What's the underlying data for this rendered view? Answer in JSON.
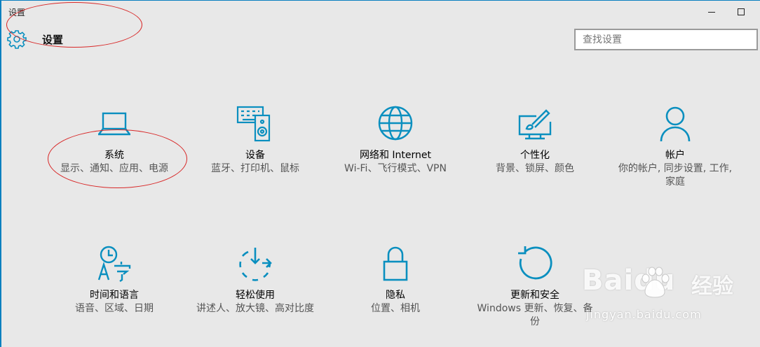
{
  "window": {
    "title": "设置"
  },
  "header": {
    "title": "设置"
  },
  "search": {
    "placeholder": "查找设置"
  },
  "accent": "#0a8fbf",
  "tiles": [
    {
      "name": "系统",
      "desc": "显示、通知、应用、电源",
      "icon": "laptop-icon"
    },
    {
      "name": "设备",
      "desc": "蓝牙、打印机、鼠标",
      "icon": "devices-icon"
    },
    {
      "name": "网络和 Internet",
      "desc": "Wi-Fi、飞行模式、VPN",
      "icon": "globe-icon"
    },
    {
      "name": "个性化",
      "desc": "背景、锁屏、颜色",
      "icon": "paint-brush-icon"
    },
    {
      "name": "帐户",
      "desc": "你的帐户, 同步设置, 工作, 家庭",
      "icon": "person-icon"
    },
    {
      "name": "时间和语言",
      "desc": "语音、区域、日期",
      "icon": "time-language-icon"
    },
    {
      "name": "轻松使用",
      "desc": "讲述人、放大镜、高对比度",
      "icon": "ease-of-access-icon"
    },
    {
      "name": "隐私",
      "desc": "位置、相机",
      "icon": "lock-icon"
    },
    {
      "name": "更新和安全",
      "desc": "Windows 更新、恢复、备份",
      "icon": "update-icon"
    }
  ],
  "watermark": {
    "logo": "Baidu",
    "cn": "经验",
    "url": "jingyan.baidu.com"
  }
}
